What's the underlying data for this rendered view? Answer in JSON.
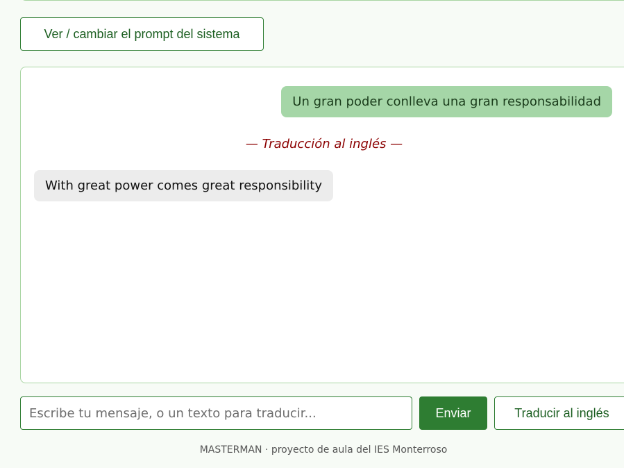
{
  "toolbar": {
    "system_prompt_button": "Ver / cambiar el prompt del sistema"
  },
  "chat": {
    "messages": [
      {
        "role": "user",
        "text": "Un gran poder conlleva una gran responsabilidad"
      },
      {
        "role": "separator",
        "text": "— Traducción al inglés —"
      },
      {
        "role": "assistant",
        "text": "With great power comes great responsibility"
      }
    ]
  },
  "composer": {
    "input_value": "",
    "input_placeholder": "Escribe tu mensaje, o un texto para traducir...",
    "send_label": "Enviar",
    "translate_label": "Traducir al inglés"
  },
  "footer": {
    "text": "MASTERMAN · proyecto de aula del IES Monterroso"
  },
  "colors": {
    "accent": "#2e7d32",
    "user_bubble": "#a5d6a7",
    "assistant_bubble": "#ececec",
    "separator_text": "#8b0000",
    "panel_border": "#a8d5a2"
  }
}
